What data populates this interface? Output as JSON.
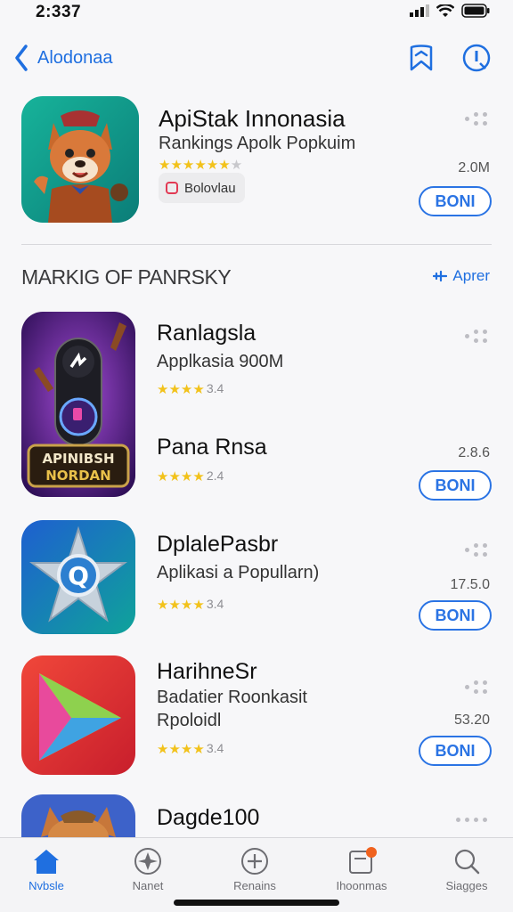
{
  "status": {
    "time": "2:337"
  },
  "nav": {
    "back_label": "Alodonaa"
  },
  "featured": {
    "title": "ApiStak Innonasia",
    "subtitle": "Rankings Apolk Popkuim",
    "rating": 4.5,
    "badge": "Bolovlau",
    "size": "2.0M",
    "get_label": "BONI",
    "icon": "fox-mascot-icon"
  },
  "section": {
    "title": "MARKIG OF PANRSKY",
    "link": "Aprer"
  },
  "apps": [
    {
      "name": "Ranlagsla",
      "subtitle": "Applkasia 900M",
      "rating": 3.5,
      "rating_count": "3.4",
      "icon": "apps-logo-icon",
      "icon_text_1": "APINIBSH",
      "icon_text_2": "NORDAN"
    },
    {
      "name": "Pana Rnsa",
      "rating": 3.5,
      "rating_count": "2.4",
      "size": "2.8.6",
      "get_label": "BONI"
    },
    {
      "name": "DplalePasbr",
      "subtitle": "Aplikasi a Popullarn)",
      "rating": 3.5,
      "rating_count": "3.4",
      "size": "17.5.0",
      "get_label": "BONI",
      "icon": "star-compass-icon"
    },
    {
      "name": "HarihneSr",
      "subtitle": "Badatier Roonkasit",
      "subtitle2": "Rpoloidl",
      "rating": 3.5,
      "rating_count": "3.4",
      "size": "53.20",
      "get_label": "BONI",
      "icon": "play-triangle-icon"
    },
    {
      "name": "Dagde100",
      "icon": "fox-mascot-icon"
    }
  ],
  "tabs": [
    {
      "label": "Nvbsle",
      "icon": "home-icon",
      "active": true
    },
    {
      "label": "Nanet",
      "icon": "compass-icon",
      "active": false
    },
    {
      "label": "Renains",
      "icon": "plus-circle-icon",
      "active": false
    },
    {
      "label": "Ihoonmas",
      "icon": "updates-icon",
      "active": false
    },
    {
      "label": "Siagges",
      "icon": "search-icon",
      "active": false
    }
  ],
  "colors": {
    "accent": "#2b74e4",
    "star": "#f2c21b"
  }
}
